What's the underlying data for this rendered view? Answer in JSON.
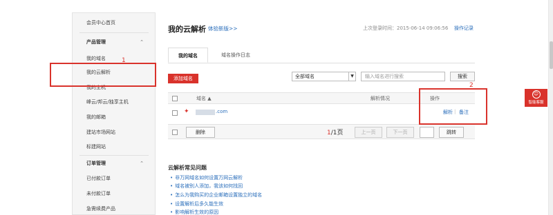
{
  "sidebar": {
    "home": "会员中心首页",
    "section_product": "产品管理",
    "items": [
      {
        "label": "我的域名"
      },
      {
        "label": "我的云解析"
      },
      {
        "label": "我的主机"
      },
      {
        "label": "峰云/邦云/独享主机"
      },
      {
        "label": "我的邮箱"
      },
      {
        "label": "建站市场网站"
      },
      {
        "label": "标建网站"
      }
    ],
    "section_order": "订单管理",
    "order_items": [
      {
        "label": "已付款订单"
      },
      {
        "label": "未付款订单"
      },
      {
        "label": "急需续费产品"
      }
    ],
    "chevron": "⌃"
  },
  "annotations": {
    "one": "1",
    "two": "2"
  },
  "header": {
    "title": "我的云解析",
    "subtitle": "体验新版>>",
    "login_time": "上次登录时间：2015-06-14 09:06:56",
    "oplog": "操作记录"
  },
  "tabs": [
    {
      "label": "我的域名"
    },
    {
      "label": "域名操作日志"
    }
  ],
  "toolbar": {
    "add_label": "添加域名",
    "select_value": "全部域名",
    "search_placeholder": "输入域名进行搜索",
    "search_label": "搜索"
  },
  "table": {
    "col_domain": "域名",
    "sort_arrow": "▲",
    "col_status": "解析情况",
    "col_action": "操作",
    "row": {
      "domain": ".com",
      "resolve_link": "解析",
      "divider": "|",
      "note_link": "备注"
    }
  },
  "pager": {
    "delete_label": "删除",
    "current": "1",
    "total": "/1页",
    "prev_label": "上一页",
    "next_label": "下一页",
    "jump_label": "跳转"
  },
  "faq": {
    "title": "云解析常见问题",
    "items": [
      "非万网域名如何设置万网云解析",
      "域名被别人添加，我该如何找回",
      "怎么为我购买的企业邮箱设置独立的域名",
      "设置解析后多久能生效",
      "影响解析生效的原因"
    ]
  },
  "service": {
    "label": "智能客服"
  },
  "colors": {
    "accent_red": "#d9322b",
    "link_blue": "#2a6ebb"
  }
}
